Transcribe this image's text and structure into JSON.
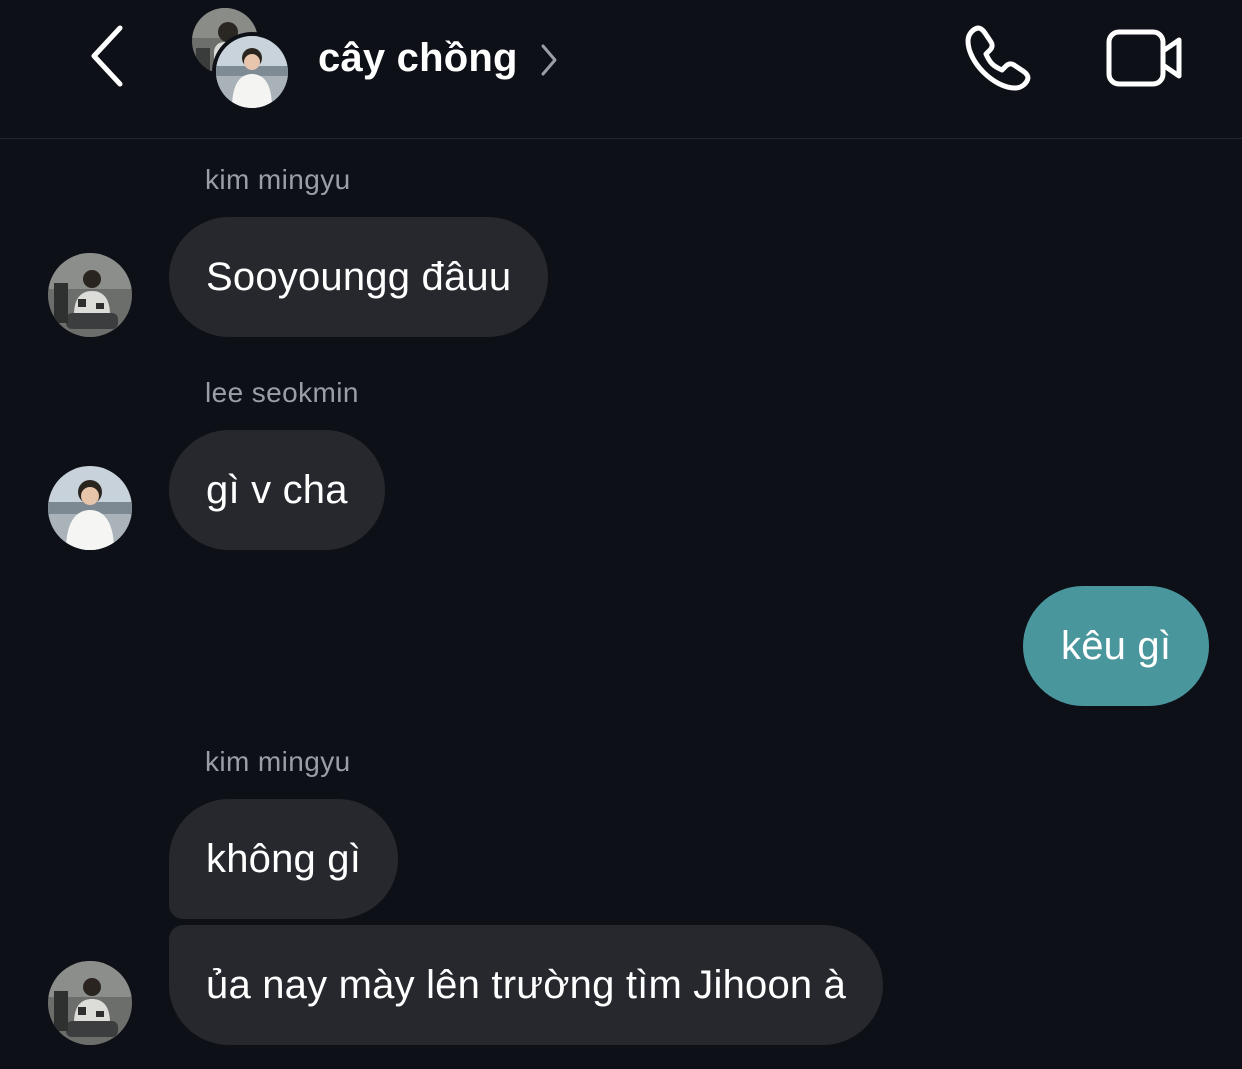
{
  "header": {
    "title": "cây chồng",
    "back_icon": "chevron-left-icon",
    "info_icon": "chevron-right-icon",
    "call_icon": "phone-icon",
    "video_icon": "video-camera-icon"
  },
  "messages": [
    {
      "sender": "kim mingyu",
      "text": "Sooyoungg đâuu",
      "from_me": false
    },
    {
      "sender": "lee seokmin",
      "text": "gì v cha",
      "from_me": false
    },
    {
      "sender": "",
      "text": "kêu gì",
      "from_me": true
    },
    {
      "sender": "kim mingyu",
      "text": "không gì",
      "from_me": false
    },
    {
      "sender": "",
      "text": "ủa nay mày lên trường tìm Jihoon à",
      "from_me": false
    }
  ],
  "colors": {
    "background": "#0d1017",
    "incoming_bubble": "#26282e",
    "outgoing_bubble": "#4a969d",
    "sender_name": "#9a9ea6"
  }
}
